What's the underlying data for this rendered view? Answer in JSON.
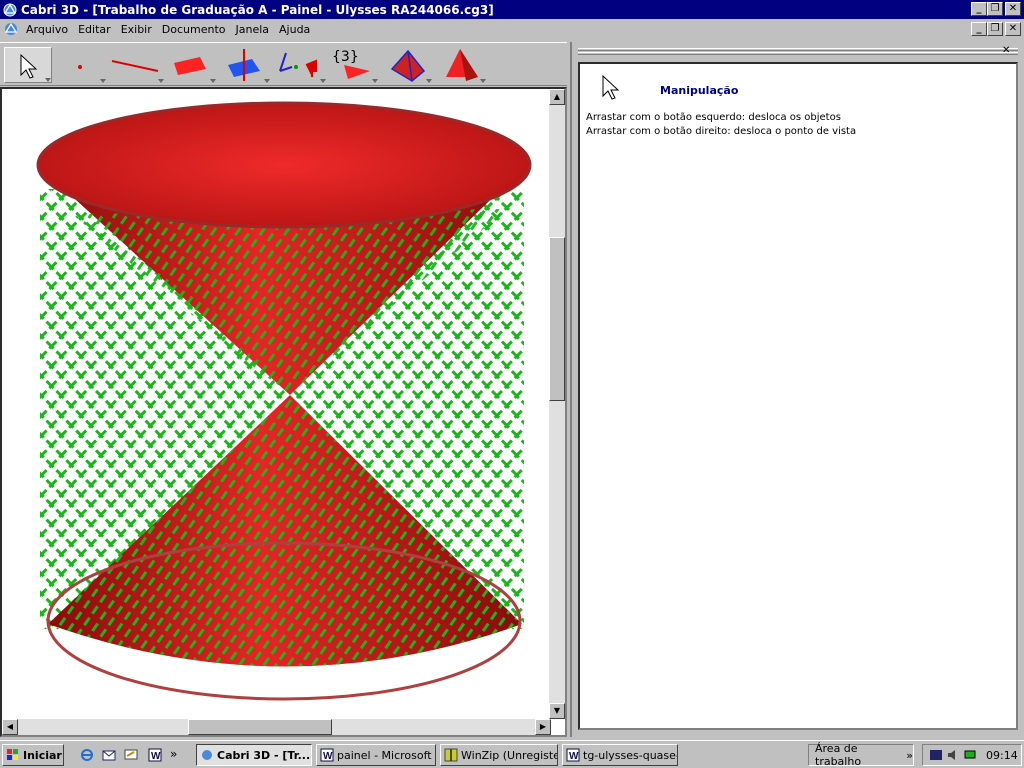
{
  "window": {
    "title": "Cabri 3D - [Trabalho de Graduação A - Painel - Ulysses RA244066.cg3]",
    "min": "_",
    "restore": "❐",
    "close": "✕"
  },
  "menu": {
    "items": [
      "Arquivo",
      "Editar",
      "Exibir",
      "Documento",
      "Janela",
      "Ajuda"
    ]
  },
  "toolbar": {
    "tools": [
      "pointer-tool",
      "point-tool",
      "line-tool",
      "plane-tool",
      "perpendicular-tool",
      "transform-tool",
      "measure-tool",
      "polygon-tool",
      "polyhedron-tool",
      "regular-polyhedron-tool"
    ],
    "calc_label": "{3}"
  },
  "panel": {
    "heading": "Manipulação",
    "line1": "Arrastar com o botão esquerdo: desloca os objetos",
    "line2": "Arrastar com o botão direito: desloca o ponto de vista",
    "close": "✕"
  },
  "taskbar": {
    "start": "Iniciar",
    "buttons": [
      "Cabri 3D - [Tr...",
      "painel - Microsoft ...",
      "WinZip (Unregiste...",
      "tg-ulysses-quase-f..."
    ],
    "area": "Área de trabalho",
    "chev": "»",
    "clock": "09:14"
  },
  "colors": {
    "cone_red": "#d81c1c",
    "mesh_green": "#1ab51a",
    "title_blue": "#000080"
  }
}
